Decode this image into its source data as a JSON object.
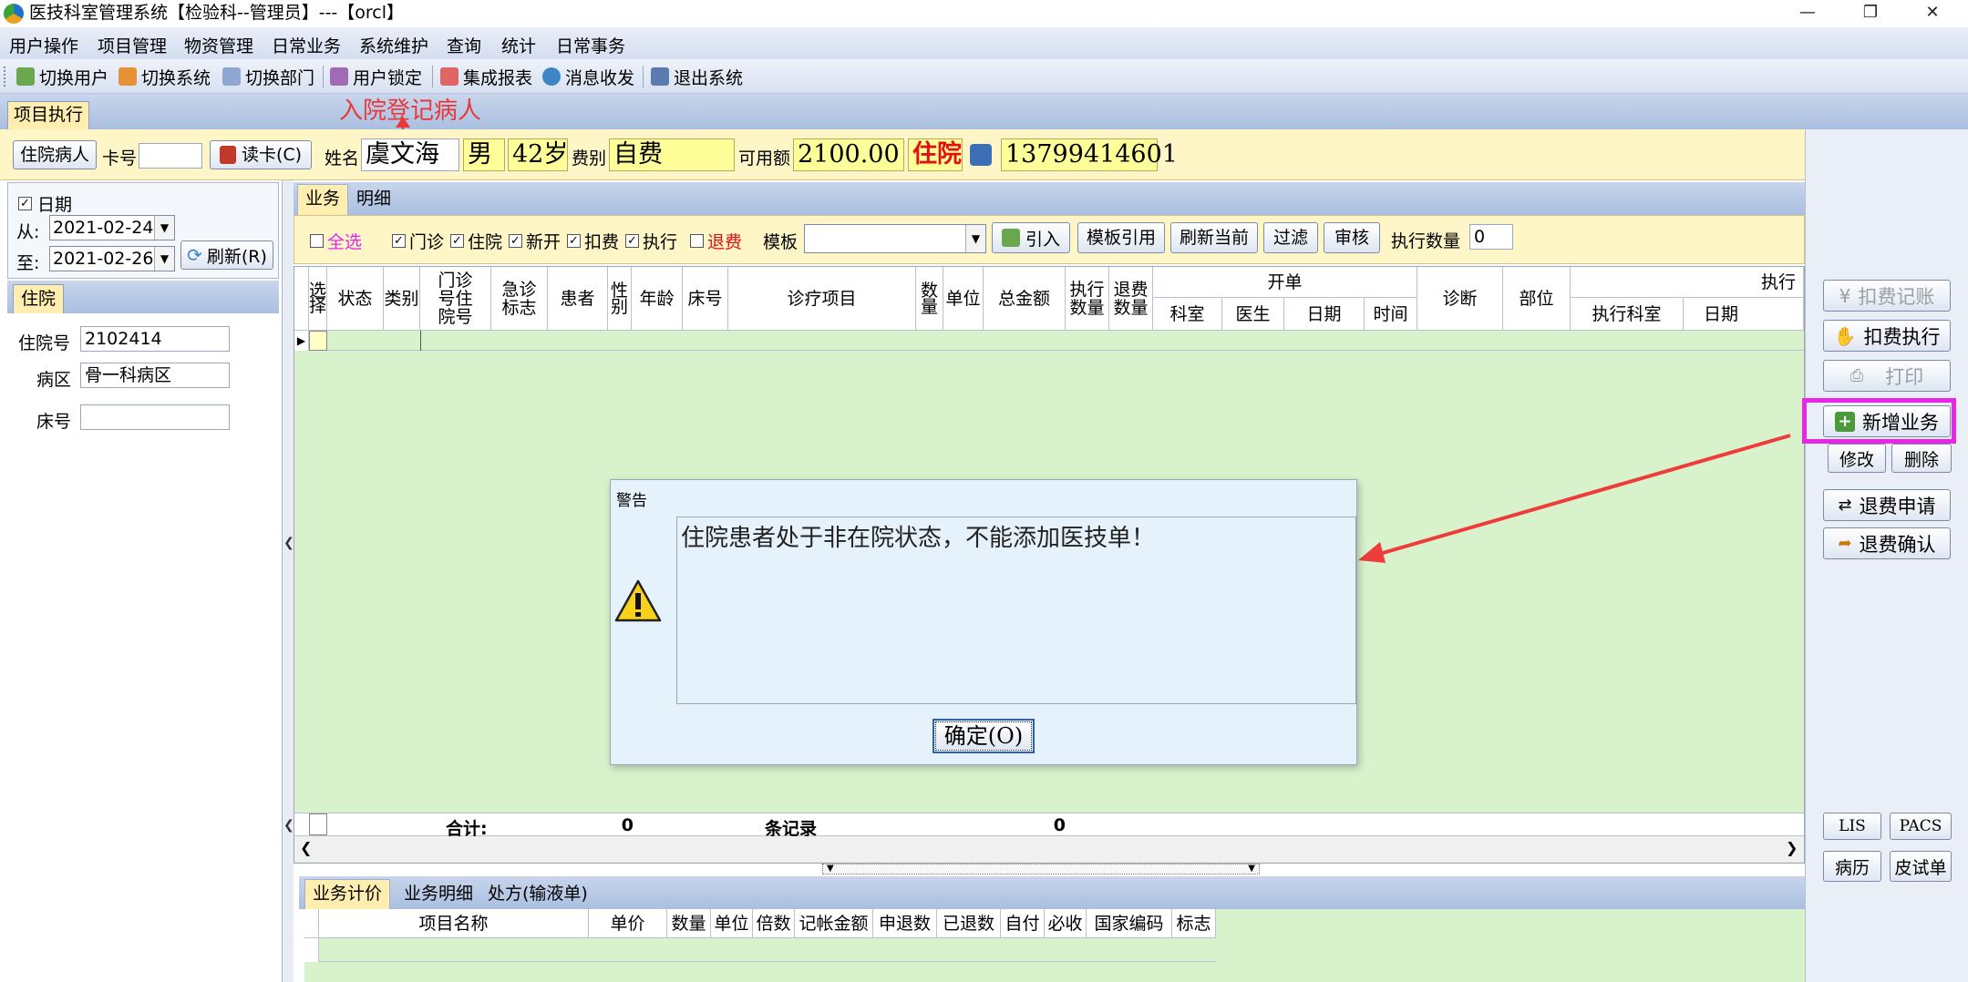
{
  "title": "医技科室管理系统【检验科--管理员】---【orcl】",
  "menu": [
    "用户操作",
    "项目管理",
    "物资管理",
    "日常业务",
    "系统维护",
    "查询",
    "统计",
    "日常事务"
  ],
  "toolbar": [
    "切换用户",
    "切换系统",
    "切换部门",
    "用户锁定",
    "集成报表",
    "消息收发",
    "退出系统"
  ],
  "main_tab": "项目执行",
  "annotation_top": "入院登记病人",
  "patient": {
    "type_button": "住院病人",
    "card_label": "卡号",
    "card_value": "",
    "read_card": "读卡(C)",
    "name_label": "姓名",
    "name": "虞文海",
    "sex": "男",
    "age": "42岁",
    "fee_label": "费别",
    "fee_type": "自费",
    "balance_label": "可用额",
    "balance": "2100.00",
    "status": "住院",
    "phone": "13799414601"
  },
  "filter": {
    "date_label": "日期",
    "date_checked": true,
    "from_label": "从:",
    "from_date": "2021-02-24",
    "to_label": "至:",
    "to_date": "2021-02-26",
    "refresh": "刷新(R)"
  },
  "inpatient": {
    "tab": "住院",
    "admit_label": "住院号",
    "admit_no": "2102414",
    "ward_label": "病区",
    "ward": "骨一科病区",
    "bed_label": "床号",
    "bed": ""
  },
  "subtabs": [
    "业务",
    "明细"
  ],
  "options": {
    "select_all": "全选",
    "checks": [
      {
        "label": "门诊",
        "checked": true
      },
      {
        "label": "住院",
        "checked": true
      },
      {
        "label": "新开",
        "checked": true
      },
      {
        "label": "扣费",
        "checked": true
      },
      {
        "label": "执行",
        "checked": true
      }
    ],
    "refund": "退费",
    "template_label": "模板",
    "template_value": "",
    "buttons": [
      "引入",
      "模板引用",
      "刷新当前",
      "过滤",
      "审核"
    ],
    "exec_count_label": "执行数量",
    "exec_count": "0"
  },
  "grid": {
    "columns": [
      "选择",
      "状态",
      "类别",
      "门诊号住院号",
      "急诊标志",
      "患者",
      "性别",
      "年龄",
      "床号",
      "诊疗项目",
      "数量",
      "单位",
      "总金额",
      "执行数量",
      "退费数量",
      "科室",
      "医生",
      "日期",
      "时间",
      "诊断",
      "部位",
      "执行科室",
      "日期"
    ],
    "group_open": "开单",
    "group_exec": "执行",
    "total_label": "合计:",
    "total_count": "0",
    "records_label": "条记录",
    "total_amount": "0"
  },
  "bottom": {
    "tabs": [
      "业务计价",
      "业务明细",
      "处方(输液单)"
    ],
    "columns": [
      "项目名称",
      "单价",
      "数量",
      "单位",
      "倍数",
      "记帐金额",
      "申退数",
      "已退数",
      "自付",
      "必收",
      "国家编码",
      "标志"
    ]
  },
  "right_buttons": [
    {
      "label": "扣费记账",
      "enabled": false
    },
    {
      "label": "扣费执行",
      "enabled": true
    },
    {
      "label": "打印",
      "enabled": false
    },
    {
      "label": "新增业务",
      "enabled": true
    },
    {
      "label": "修改",
      "enabled": true
    },
    {
      "label": "删除",
      "enabled": true
    },
    {
      "label": "退费申请",
      "enabled": true
    },
    {
      "label": "退费确认",
      "enabled": true
    },
    {
      "label": "LIS",
      "enabled": true
    },
    {
      "label": "PACS",
      "enabled": true
    },
    {
      "label": "病历",
      "enabled": true
    },
    {
      "label": "皮试单",
      "enabled": true
    }
  ],
  "dialog": {
    "title": "警告",
    "message": "住院患者处于非在院状态，不能添加医技单！",
    "ok": "确定(O)",
    "icon": "warning-icon"
  },
  "colors": {
    "grid_bg": "#d8f2cc",
    "highlight": "#e628e6",
    "arrow": "#ee3b3b",
    "annotation": "#e83838"
  }
}
